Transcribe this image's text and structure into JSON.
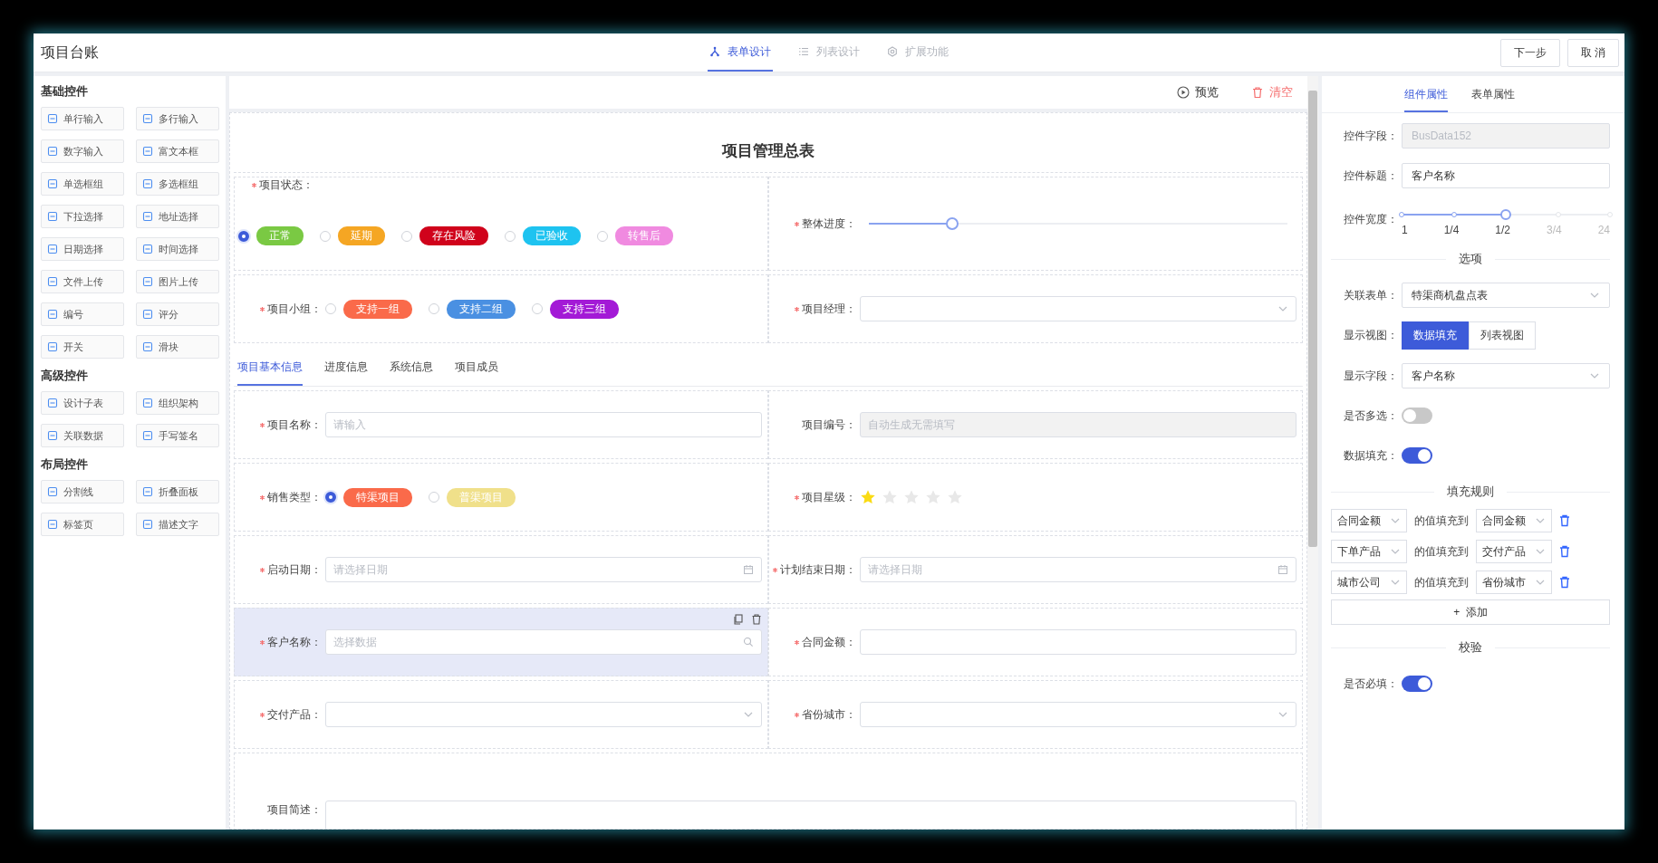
{
  "header": {
    "title": "项目台账",
    "tabs": [
      {
        "label": "表单设计",
        "selected": true,
        "kind": "nodes"
      },
      {
        "label": "列表设计",
        "selected": false,
        "kind": "list"
      },
      {
        "label": "扩展功能",
        "selected": false,
        "kind": "gear"
      }
    ],
    "buttons": [
      "下一步",
      "取 消"
    ]
  },
  "palette": [
    {
      "title": "基础控件",
      "items": [
        "单行输入",
        "多行输入",
        "数字输入",
        "富文本框",
        "单选框组",
        "多选框组",
        "下拉选择",
        "地址选择",
        "日期选择",
        "时间选择",
        "文件上传",
        "图片上传",
        "编号",
        "评分",
        "开关",
        "滑块"
      ]
    },
    {
      "title": "高级控件",
      "items": [
        "设计子表",
        "组织架构",
        "关联数据",
        "手写签名"
      ]
    },
    {
      "title": "布局控件",
      "items": [
        "分割线",
        "折叠面板",
        "标签页",
        "描述文字"
      ]
    }
  ],
  "canvas_toolbar": [
    {
      "label": "预览",
      "kind": "preview"
    },
    {
      "label": "清空",
      "kind": "clear"
    }
  ],
  "form": {
    "title": "项目管理总表",
    "rows": [
      {
        "kind": "fields",
        "cells": [
          {
            "kind": "tag-radio",
            "label": "项目状态：",
            "required": true,
            "selected": false,
            "label_above": true,
            "options": [
              {
                "label": "正常",
                "color": "#7ac943",
                "selected": true
              },
              {
                "label": "延期",
                "color": "#f5a623",
                "selected": false
              },
              {
                "label": "存在风险",
                "color": "#d0021b",
                "selected": false
              },
              {
                "label": "已验收",
                "color": "#1ec3f0",
                "selected": false
              },
              {
                "label": "转售后",
                "color": "#f08ae0",
                "selected": false
              }
            ]
          },
          {
            "kind": "slider",
            "label": "整体进度：",
            "required": true,
            "selected": false,
            "level": 0.2
          }
        ]
      },
      {
        "kind": "fields",
        "cells": [
          {
            "kind": "tag-radio",
            "label": "项目小组：",
            "required": true,
            "selected": false,
            "label_above": false,
            "options": [
              {
                "label": "支持一组",
                "color": "#fa6a4a",
                "selected": false
              },
              {
                "label": "支持二组",
                "color": "#4a90e2",
                "selected": false
              },
              {
                "label": "支持三组",
                "color": "#a31ad6",
                "selected": false
              }
            ]
          },
          {
            "kind": "select",
            "label": "项目经理：",
            "required": true,
            "selected": false
          }
        ]
      },
      {
        "kind": "tabs",
        "tabs": [
          {
            "label": "项目基本信息",
            "selected": true
          },
          {
            "label": "进度信息",
            "selected": false
          },
          {
            "label": "系统信息",
            "selected": false
          },
          {
            "label": "项目成员",
            "selected": false
          }
        ]
      },
      {
        "kind": "fields",
        "cells": [
          {
            "kind": "input",
            "label": "项目名称：",
            "required": true,
            "selected": false,
            "placeholder": "请输入",
            "disabled": false
          },
          {
            "kind": "input",
            "label": "项目编号：",
            "required": false,
            "selected": false,
            "placeholder": "自动生成无需填写",
            "disabled": true
          }
        ]
      },
      {
        "kind": "fields",
        "cells": [
          {
            "kind": "tag-radio",
            "label": "销售类型：",
            "required": true,
            "selected": false,
            "label_above": false,
            "options": [
              {
                "label": "特渠项目",
                "color": "#fa6a4a",
                "selected": true
              },
              {
                "label": "普渠项目",
                "color": "#f0e08a",
                "selected": false
              }
            ]
          },
          {
            "kind": "stars",
            "label": "项目星级：",
            "required": true,
            "selected": false,
            "stars": 1
          }
        ]
      },
      {
        "kind": "fields",
        "cells": [
          {
            "kind": "date",
            "label": "启动日期：",
            "required": true,
            "selected": false,
            "placeholder": "请选择日期"
          },
          {
            "kind": "date",
            "label": "计划结束日期：",
            "required": true,
            "selected": false,
            "placeholder": "请选择日期"
          }
        ]
      },
      {
        "kind": "fields",
        "cells": [
          {
            "kind": "lookup",
            "label": "客户名称：",
            "required": true,
            "selected": true,
            "placeholder": "选择数据"
          },
          {
            "kind": "input",
            "label": "合同金额：",
            "required": true,
            "selected": false,
            "disabled": false
          }
        ]
      },
      {
        "kind": "fields",
        "cells": [
          {
            "kind": "select",
            "label": "交付产品：",
            "required": true,
            "selected": false
          },
          {
            "kind": "select",
            "label": "省份城市：",
            "required": true,
            "selected": false
          }
        ]
      },
      {
        "kind": "fields",
        "cells": [
          {
            "kind": "textarea",
            "label": "项目简述：",
            "required": false,
            "selected": false
          }
        ]
      }
    ]
  },
  "properties": {
    "tabs": [
      {
        "label": "组件属性",
        "selected": true
      },
      {
        "label": "表单属性",
        "selected": false
      }
    ],
    "items": [
      {
        "kind": "input",
        "label": "控件字段：",
        "value": "BusData152",
        "disabled": true
      },
      {
        "kind": "input",
        "label": "控件标题：",
        "value": "客户名称",
        "disabled": false
      },
      {
        "kind": "width-slider",
        "label": "控件宽度：",
        "marks": [
          "1",
          "1/4",
          "1/2",
          "3/4",
          "24"
        ],
        "level": 0.5
      },
      {
        "kind": "section",
        "title": "选项"
      },
      {
        "kind": "select",
        "label": "关联表单：",
        "value": "特渠商机盘点表"
      },
      {
        "kind": "segmented",
        "label": "显示视图：",
        "options": [
          {
            "label": "数据填充",
            "selected": true
          },
          {
            "label": "列表视图",
            "selected": false
          }
        ]
      },
      {
        "kind": "select",
        "label": "显示字段：",
        "value": "客户名称"
      },
      {
        "kind": "switch",
        "label": "是否多选：",
        "on": false
      },
      {
        "kind": "switch",
        "label": "数据填充：",
        "on": true
      },
      {
        "kind": "section",
        "title": "填充规则"
      },
      {
        "kind": "rules",
        "rules": [
          {
            "from": "合同金额",
            "link": "的值填充到",
            "to": "合同金额"
          },
          {
            "from": "下单产品",
            "link": "的值填充到",
            "to": "交付产品"
          },
          {
            "from": "城市公司",
            "link": "的值填充到",
            "to": "省份城市"
          }
        ]
      },
      {
        "kind": "add",
        "plus": "+",
        "label": "添加"
      },
      {
        "kind": "section",
        "title": "校验"
      },
      {
        "kind": "switch",
        "label": "是否必填：",
        "on": true
      }
    ]
  }
}
